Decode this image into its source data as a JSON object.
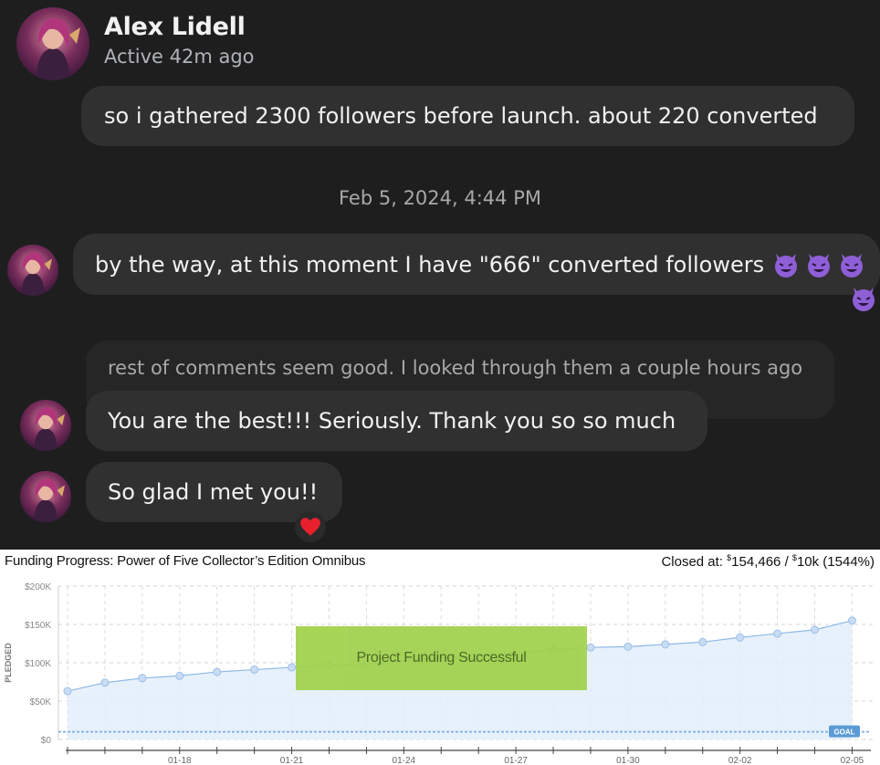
{
  "contact": {
    "name": "Alex Lidell",
    "status": "Active 42m ago"
  },
  "messages": [
    {
      "text": "so i gathered 2300 followers before launch. about 220 converted"
    },
    {
      "text": "by the way, at this moment I have \"666\" converted followers"
    },
    {
      "text": "rest of comments seem good. I looked through them a couple hours ago"
    },
    {
      "text": "You are the best!!! Seriously. Thank you so so much"
    },
    {
      "text": "So glad I met you!!"
    }
  ],
  "timestamp": "Feb 5, 2024, 4:44 PM",
  "icons": {
    "devil_emoji": "smiling-face-with-horns-icon",
    "reaction": "red-heart-icon"
  },
  "colors": {
    "chat_bg": "#1e1e1f",
    "bubble": "#303030",
    "reply_bubble": "#262627",
    "heart": "#e8202e",
    "devil": "#8e5fd6",
    "chart_area": "#e3eefa",
    "chart_line": "#8fb8e6",
    "goal_badge": "#5b9bd5",
    "banner": "#9fd14a"
  },
  "funding": {
    "title": "Funding Progress: Power of Five Collector’s Edition Omnibus",
    "closed_label": "Closed at:",
    "closed_amount_symbol": "$",
    "closed_amount": "154,466",
    "goal_symbol": "$",
    "goal_amount": "10k",
    "percent": "(1544%)",
    "banner_text": "Project Funding Successful",
    "goal_label": "GOAL"
  },
  "chart_data": {
    "type": "area",
    "ylabel": "PLEDGED",
    "ylim": [
      0,
      200000
    ],
    "y_ticks": [
      "$0",
      "$50K",
      "$100K",
      "$150K",
      "$200K"
    ],
    "y_tick_values": [
      0,
      50000,
      100000,
      150000,
      200000
    ],
    "x_tick_labels": [
      "01-18",
      "01-21",
      "01-24",
      "01-27",
      "01-30",
      "02-02",
      "02-05"
    ],
    "x_tick_days": [
      3,
      6,
      9,
      12,
      15,
      18,
      21
    ],
    "goal": 10000,
    "series": [
      {
        "days": [
          0,
          1,
          2,
          3,
          4,
          5,
          6,
          7,
          8,
          13,
          14,
          15,
          16,
          17,
          18,
          19,
          20,
          21
        ],
        "values": [
          63000,
          74000,
          80000,
          83000,
          88000,
          91000,
          94000,
          97000,
          99000,
          117000,
          120000,
          121000,
          124000,
          127000,
          133000,
          138000,
          143000,
          155000
        ]
      }
    ],
    "grid": true
  }
}
